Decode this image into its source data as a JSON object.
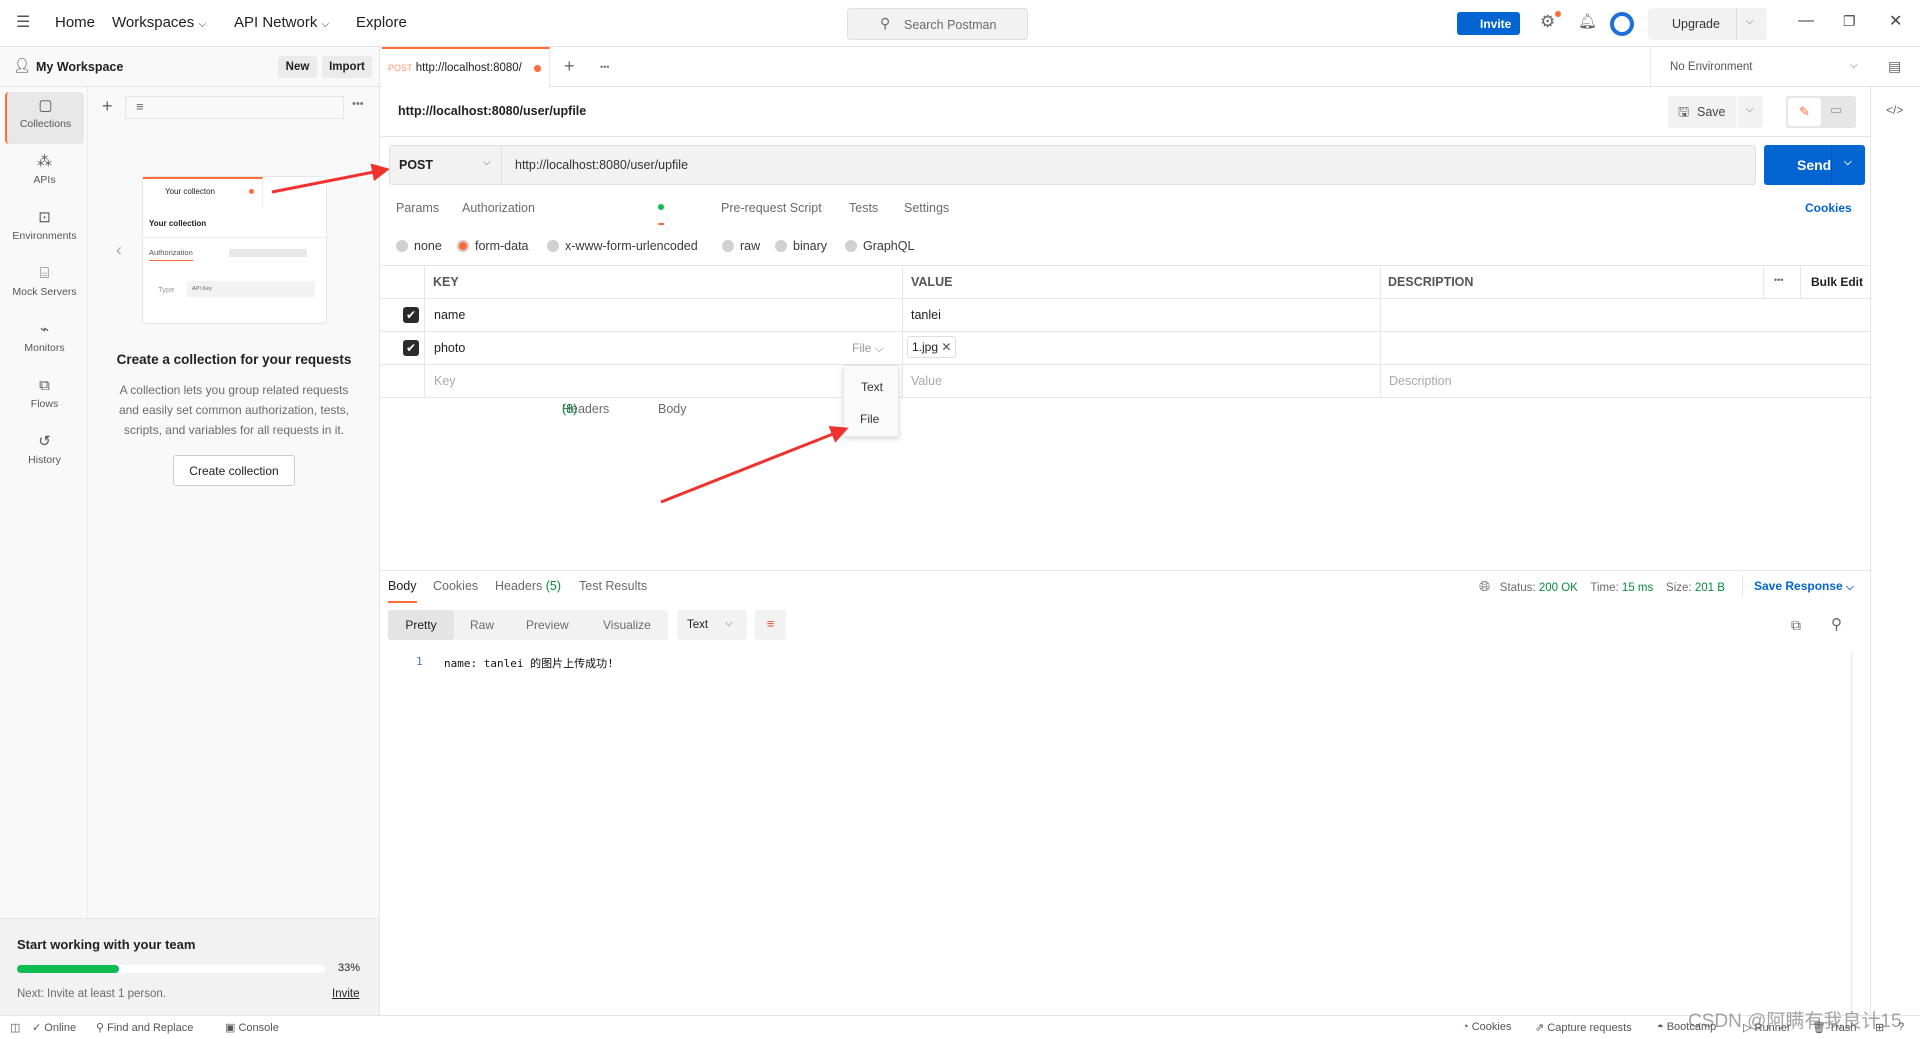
{
  "topbar": {
    "menu_icon": "hamburger-icon",
    "nav": [
      "Home",
      "Workspaces",
      "API Network",
      "Explore"
    ],
    "search_placeholder": "Search Postman",
    "invite": "Invite",
    "upgrade": "Upgrade"
  },
  "workspace": {
    "title": "My Workspace",
    "new": "New",
    "import": "Import"
  },
  "rail": [
    {
      "label": "Collections",
      "icon": "collection-icon"
    },
    {
      "label": "APIs",
      "icon": "apis-icon"
    },
    {
      "label": "Environments",
      "icon": "environment-icon"
    },
    {
      "label": "Mock Servers",
      "icon": "server-icon"
    },
    {
      "label": "Monitors",
      "icon": "monitor-icon"
    },
    {
      "label": "Flows",
      "icon": "flows-icon"
    },
    {
      "label": "History",
      "icon": "history-icon"
    }
  ],
  "empty": {
    "illus_tab": "Your collecton",
    "illus_title": "Your collection",
    "illus_auth": "Authorization",
    "illus_type": "Type",
    "illus_type_val": "API Key",
    "heading": "Create a collection for your requests",
    "desc1": "A collection lets you group related requests",
    "desc2": "and easily set common authorization, tests,",
    "desc3": "scripts, and variables for all requests in it.",
    "button": "Create collection"
  },
  "onboarding": {
    "title": "Start working with your team",
    "progress_pct": 33,
    "progress_label": "33%",
    "next": "Next: Invite at least 1 person.",
    "invite": "Invite"
  },
  "tab": {
    "method": "POST",
    "url": "http://localhost:8080/"
  },
  "environment": "No Environment",
  "request": {
    "title": "http://localhost:8080/user/upfile",
    "save": "Save",
    "method": "POST",
    "url": "http://localhost:8080/user/upfile",
    "send": "Send",
    "cookies": "Cookies",
    "tabs": [
      "Params",
      "Authorization",
      "Headers",
      "(8)",
      "Body",
      "Pre-request Script",
      "Tests",
      "Settings"
    ],
    "body_types": [
      "none",
      "form-data",
      "x-www-form-urlencoded",
      "raw",
      "binary",
      "GraphQL"
    ],
    "table": {
      "headers": [
        "KEY",
        "VALUE",
        "DESCRIPTION"
      ],
      "bulk_edit": "Bulk Edit",
      "rows": [
        {
          "key": "name",
          "value": "tanlei",
          "checked": true
        },
        {
          "key": "photo",
          "type": "File",
          "value": "1.jpg",
          "checked": true
        }
      ],
      "placeholders": {
        "key": "Key",
        "value": "Value",
        "description": "Description"
      }
    },
    "type_menu": [
      "Text",
      "File"
    ]
  },
  "response": {
    "tabs": [
      "Body",
      "Cookies",
      "Headers",
      "(5)",
      "Test Results"
    ],
    "status_label": "Status:",
    "status": "200 OK",
    "time_label": "Time:",
    "time": "15 ms",
    "size_label": "Size:",
    "size": "201 B",
    "save": "Save Response",
    "views": [
      "Pretty",
      "Raw",
      "Preview",
      "Visualize"
    ],
    "format": "Text",
    "line_no": "1",
    "body": "name: tanlei 的图片上传成功!"
  },
  "statusbar": {
    "left": [
      "Online",
      "Find and Replace",
      "Console"
    ],
    "right": [
      "Cookies",
      "Capture requests",
      "Bootcamp",
      "Runner",
      "Trash"
    ]
  },
  "watermark": "CSDN @阿瞒有我良计15",
  "colors": {
    "accent": "#ff6c37",
    "blue": "#0265d2",
    "green": "#0cbb52"
  }
}
